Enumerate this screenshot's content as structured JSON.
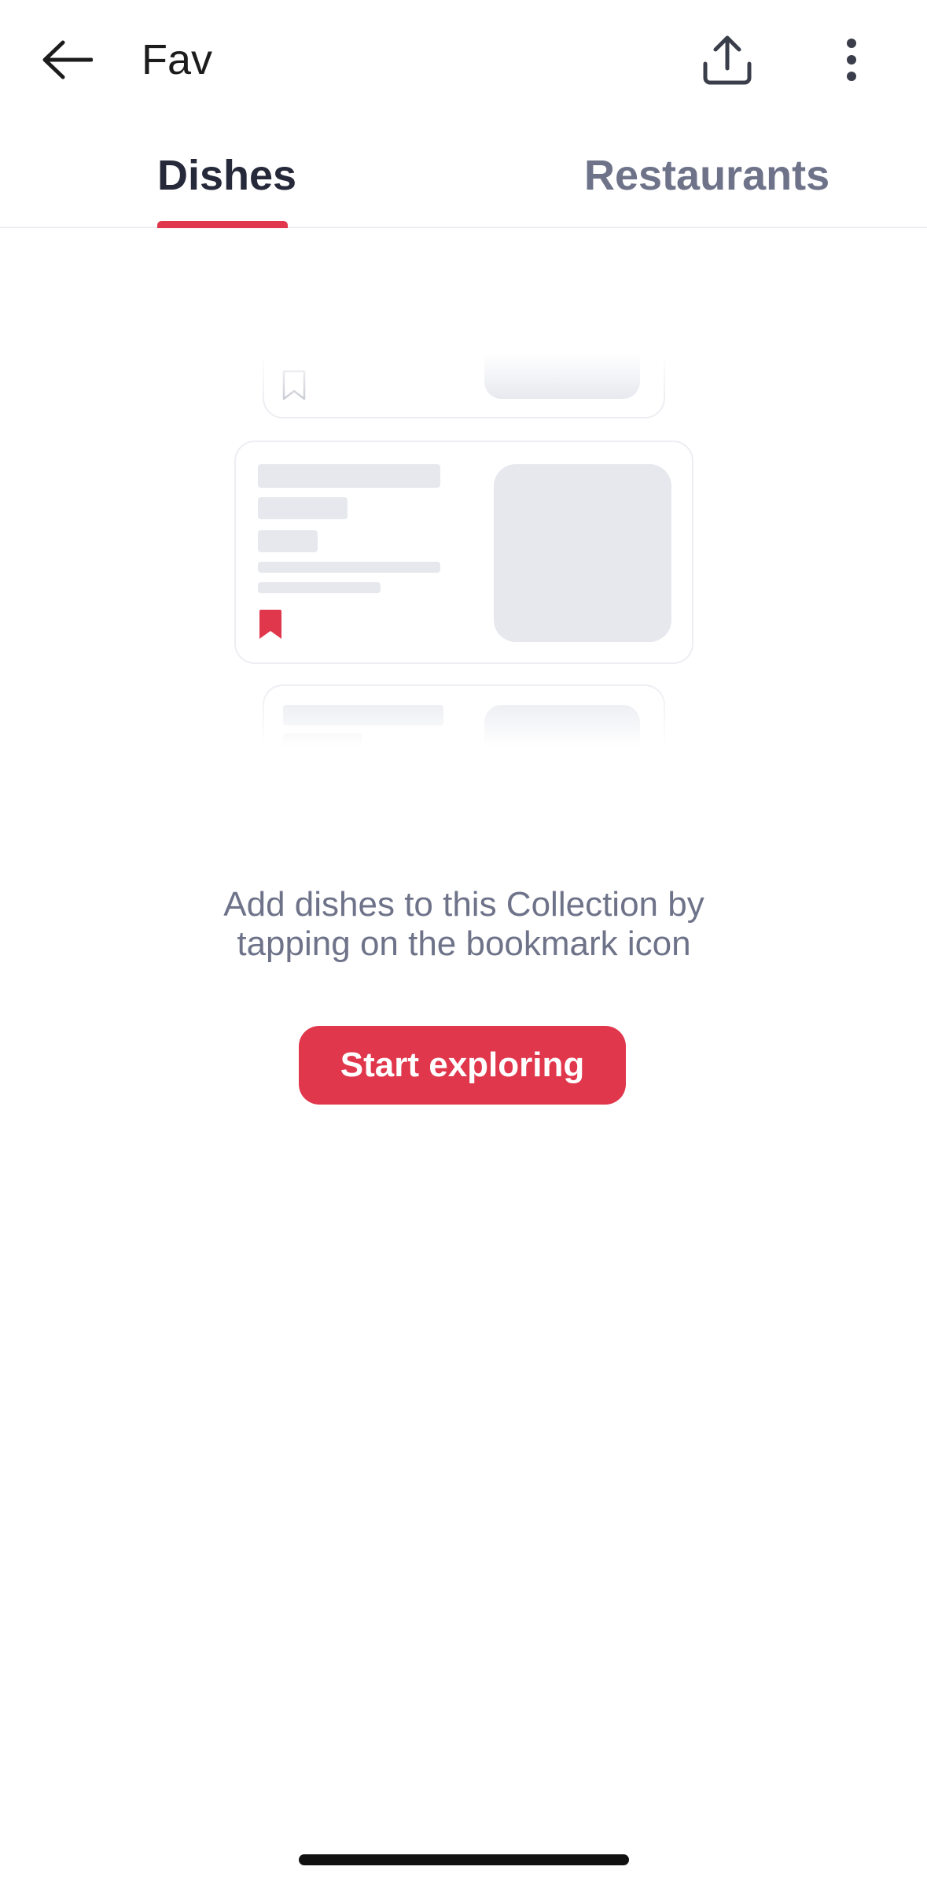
{
  "header": {
    "title": "Fav",
    "back_icon": "arrow-left-icon",
    "share_icon": "share-upload-icon",
    "more_icon": "more-vertical-icon"
  },
  "tabs": [
    {
      "label": "Dishes",
      "active": true
    },
    {
      "label": "Restaurants",
      "active": false
    }
  ],
  "empty_state": {
    "message_line1": "Add dishes to this Collection by",
    "message_line2": "tapping on the bookmark icon",
    "cta_label": "Start exploring"
  },
  "colors": {
    "accent": "#e0374c",
    "title_text": "#1c1c1c",
    "muted_text": "#6e7389",
    "placeholder": "#e6e8ee"
  }
}
